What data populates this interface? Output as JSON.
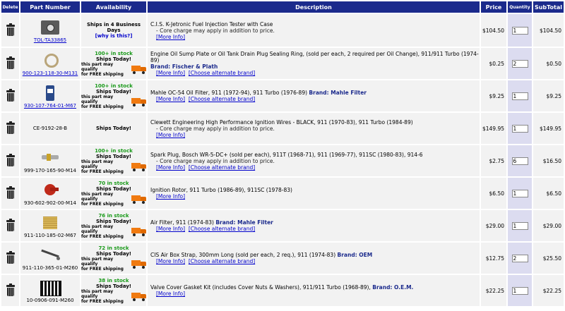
{
  "header": {
    "delete": "Delete",
    "part_number": "Part Number",
    "availability": "Availability",
    "description": "Description",
    "price": "Price",
    "quantity": "Quantity",
    "subtotal": "SubTotal"
  },
  "common": {
    "ships_today": "Ships Today!",
    "free_shipping_line1": "this part may qualify",
    "free_shipping_line2": "for FREE shipping",
    "why_link": "[why is this?]",
    "more_info": "[More Info]",
    "alternate_brand": "[Choose alternate brand]",
    "core_note": "- Core charge may apply in addition to price."
  },
  "rows": [
    {
      "part": "TOL-TA33865",
      "availability": "Ships in 4 Business Days",
      "description": "C.I.S. K-Jetronic Fuel Injection Tester with Case",
      "brand": "",
      "price": "$104.50",
      "qty": "1",
      "subtotal": "$104.50"
    },
    {
      "part": "900-123-118-30-M131",
      "stock": "100+ in stock",
      "description": "Engine Oil Sump Plate or Oil Tank Drain Plug Sealing Ring, (sold per each, 2 required per Oil Change), 911/911 Turbo (1974-89)",
      "brand": "Brand: Fischer & Plath",
      "price": "$0.25",
      "qty": "2",
      "subtotal": "$0.50"
    },
    {
      "part": "930-107-764-01-M67",
      "stock": "100+ in stock",
      "description": "Mahle OC-54 Oil Filter, 911 (1972-94), 911 Turbo (1976-89)",
      "brand": "Brand: Mahle Filter",
      "price": "$9.25",
      "qty": "1",
      "subtotal": "$9.25"
    },
    {
      "part": "CE-9192-28-B",
      "availability": "Ships Today!",
      "description": "Clewett Engineering High Performance Ignition Wires - BLACK, 911 (1970-83), 911 Turbo (1984-89)",
      "brand": "",
      "price": "$149.95",
      "qty": "1",
      "subtotal": "$149.95"
    },
    {
      "part": "999-170-165-90-M14",
      "stock": "100+ in stock",
      "description": "Spark Plug, Bosch WR-5-DC+ (sold per each), 911T (1968-71), 911 (1969-77), 911SC (1980-83), 914-6",
      "brand": "",
      "price": "$2.75",
      "qty": "6",
      "subtotal": "$16.50"
    },
    {
      "part": "930-602-902-00-M14",
      "stock": "70 in stock",
      "description": "Ignition Rotor, 911 Turbo (1986-89), 911SC (1978-83)",
      "brand": "",
      "price": "$6.50",
      "qty": "1",
      "subtotal": "$6.50"
    },
    {
      "part": "911-110-185-02-M67",
      "stock": "76 in stock",
      "description": "Air Filter, 911 (1974-83)",
      "brand": "Brand: Mahle Filter",
      "price": "$29.00",
      "qty": "1",
      "subtotal": "$29.00"
    },
    {
      "part": "911-110-365-01-M260",
      "stock": "72 in stock",
      "description": "CIS Air Box Strap, 300mm Long (sold per each, 2 req.), 911 (1974-83)",
      "brand": "Brand: OEM",
      "price": "$12.75",
      "qty": "2",
      "subtotal": "$25.50"
    },
    {
      "part": "10-0906-091-M260",
      "stock": "38 in stock",
      "description": "Valve Cover Gasket Kit (includes Cover Nuts & Washers), 911/911 Turbo (1968-89),",
      "brand": "Brand: O.E.M.",
      "price": "$22.25",
      "qty": "1",
      "subtotal": "$22.25"
    }
  ]
}
